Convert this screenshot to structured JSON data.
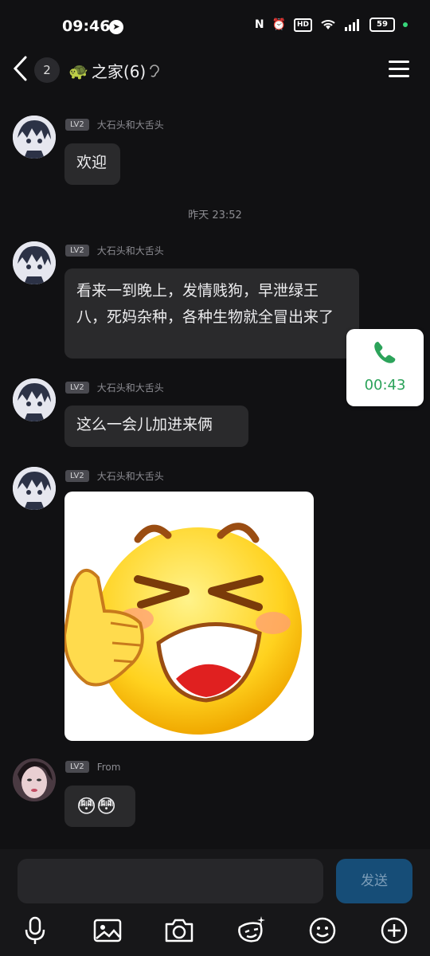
{
  "status_bar": {
    "time": "09:46",
    "battery": "59"
  },
  "header": {
    "unread_count": "2",
    "title": "之家(6)",
    "emoji": "🐢"
  },
  "messages": [
    {
      "sender": "大石头和大舌头",
      "level": "LV2",
      "text": "欢迎"
    },
    {
      "sender": "大石头和大舌头",
      "level": "LV2",
      "text": "看来一到晚上，发情贱狗，早泄绿王八，死妈杂种，各种生物就全冒出来了"
    },
    {
      "sender": "大石头和大舌头",
      "level": "LV2",
      "text": "这么一会儿加进来俩"
    },
    {
      "sender": "大石头和大舌头",
      "level": "LV2",
      "sticker": "laughing-thumbs-up-emoji"
    },
    {
      "sender": "From",
      "level": "LV2",
      "text": "😳😳"
    }
  ],
  "time_separator": "昨天 23:52",
  "call_widget": {
    "duration": "00:43",
    "icon": "phone-icon"
  },
  "composer": {
    "send_label": "发送"
  },
  "toolbar": [
    "microphone-icon",
    "image-icon",
    "camera-icon",
    "sticker-icon",
    "emoji-icon",
    "plus-icon"
  ],
  "colors": {
    "background": "#111113",
    "bubble": "#2a2a2c",
    "send": "#164d77",
    "call_green": "#2ca35a"
  }
}
